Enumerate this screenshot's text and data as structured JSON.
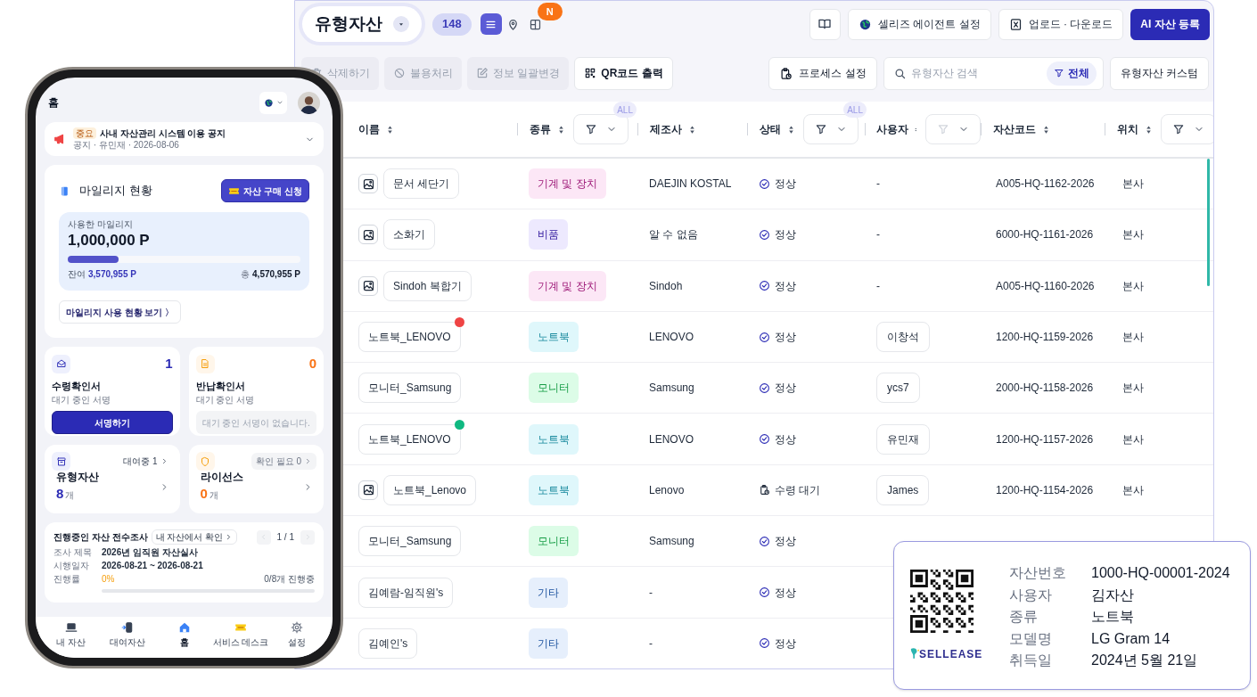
{
  "desktop": {
    "title": "유형자산",
    "count": "148",
    "views": [
      {
        "kind": "list",
        "selected": true
      },
      {
        "kind": "map",
        "selected": false
      },
      {
        "kind": "layout",
        "selected": false
      }
    ],
    "new_badge": "N",
    "actions": [
      {
        "kind": "book"
      },
      {
        "kind": "agent",
        "label": "셀리즈 에이전트 설정"
      },
      {
        "kind": "excel",
        "label": "업로드 · 다운로드"
      },
      {
        "kind": "primary",
        "label": "AI 자산 등록"
      }
    ],
    "toolbar": [
      {
        "kind": "trash",
        "label": "삭제하기",
        "disabled": true
      },
      {
        "kind": "ban",
        "label": "불용처리",
        "disabled": true
      },
      {
        "kind": "edit",
        "label": "정보 일괄변경",
        "disabled": true
      },
      {
        "kind": "qr",
        "label": "QR코드 출력",
        "disabled": false
      }
    ],
    "process_button": "프로세스 설정",
    "search": {
      "placeholder": "유형자산 검색",
      "filter_label": "전체"
    },
    "custom_button": "유형자산 커스텀",
    "table": {
      "columns": [
        {
          "label": "이름",
          "filter": false
        },
        {
          "label": "종류",
          "filter": true,
          "filter_dimmed": false,
          "badge": "ALL"
        },
        {
          "label": "제조사",
          "filter": false
        },
        {
          "label": "상태",
          "filter": true,
          "filter_dimmed": false,
          "badge": "ALL"
        },
        {
          "label": "사용자",
          "filter": true,
          "filter_dimmed": true
        },
        {
          "label": "자산코드",
          "filter": false
        },
        {
          "label": "위치",
          "filter": true,
          "filter_dimmed": false
        }
      ],
      "rows": [
        {
          "name": "문서 세단기",
          "has_image": true,
          "tag": {
            "label": "기계 및 장치",
            "color": "#fce7f6"
          },
          "maker": "DAEJIN KOSTAL",
          "status": {
            "kind": "normal",
            "label": "정상"
          },
          "user": {
            "kind": "plain",
            "label": "-"
          },
          "code": "A005-HQ-1162-2026",
          "location": "본사"
        },
        {
          "name": "소화기",
          "has_image": true,
          "tag": {
            "label": "비품",
            "color": "#ede9fe"
          },
          "maker": "알 수 없음",
          "status": {
            "kind": "normal",
            "label": "정상"
          },
          "user": {
            "kind": "plain",
            "label": "-"
          },
          "code": "6000-HQ-1161-2026",
          "location": "본사"
        },
        {
          "name": "Sindoh 복합기",
          "has_image": true,
          "tag": {
            "label": "기계 및 장치",
            "color": "#fce7f6"
          },
          "maker": "Sindoh",
          "status": {
            "kind": "normal",
            "label": "정상"
          },
          "user": {
            "kind": "plain",
            "label": "-"
          },
          "code": "A005-HQ-1160-2026",
          "location": "본사"
        },
        {
          "name": "노트북_LENOVO",
          "has_image": false,
          "dot": {
            "color": "#ef4444"
          },
          "tag": {
            "label": "노트북",
            "color": "#dff7fb"
          },
          "maker": "LENOVO",
          "status": {
            "kind": "normal",
            "label": "정상"
          },
          "user": {
            "kind": "pill",
            "label": "이창석"
          },
          "code": "1200-HQ-1159-2026",
          "location": "본사"
        },
        {
          "name": "모니터_Samsung",
          "has_image": false,
          "tag": {
            "label": "모니터",
            "color": "#dcfce7"
          },
          "maker": "Samsung",
          "status": {
            "kind": "normal",
            "label": "정상"
          },
          "user": {
            "kind": "pill",
            "label": "ycs7"
          },
          "code": "2000-HQ-1158-2026",
          "location": "본사"
        },
        {
          "name": "노트북_LENOVO",
          "has_image": false,
          "dot": {
            "color": "#10b981"
          },
          "tag": {
            "label": "노트북",
            "color": "#dff7fb"
          },
          "maker": "LENOVO",
          "status": {
            "kind": "normal",
            "label": "정상"
          },
          "user": {
            "kind": "pill",
            "label": "유민재"
          },
          "code": "1200-HQ-1157-2026",
          "location": "본사"
        },
        {
          "name": "노트북_Lenovo",
          "has_image": true,
          "tag": {
            "label": "노트북",
            "color": "#dff7fb"
          },
          "maker": "Lenovo",
          "status": {
            "kind": "pending",
            "label": "수령 대기"
          },
          "user": {
            "kind": "pill",
            "label": "James"
          },
          "code": "1200-HQ-1154-2026",
          "location": "본사"
        },
        {
          "name": "모니터_Samsung",
          "has_image": false,
          "tag": {
            "label": "모니터",
            "color": "#dcfce7"
          },
          "maker": "Samsung",
          "status": {
            "kind": "normal",
            "label": "정상"
          }
        },
        {
          "name": "김예람-임직원's",
          "has_image": false,
          "tag": {
            "label": "기타",
            "color": "#e6effc"
          },
          "maker": "-",
          "status": {
            "kind": "normal",
            "label": "정상"
          }
        },
        {
          "name": "김예인's",
          "has_image": false,
          "tag": {
            "label": "기타",
            "color": "#e6effc"
          },
          "maker": "-",
          "status": {
            "kind": "normal",
            "label": "정상"
          }
        }
      ]
    }
  },
  "phone": {
    "header_title": "홈",
    "notice": {
      "badge": "중요",
      "title": "사내 자산관리 시스템 이용 공지",
      "meta": "공지 · 유민재 · 2026-08-06"
    },
    "mileage": {
      "title": "마일리지 현황",
      "purchase_button": "자산 구매 신청",
      "used_label": "사용한 마일리지",
      "used_value": "1,000,000 P",
      "level": 0.22,
      "remain_label": "잔여",
      "remain_value": "3,570,955 P",
      "total_label": "총",
      "total_value": "4,570,955 P",
      "history_link": "마일리지 사용 현황 보기 〉"
    },
    "sign_cards": [
      {
        "kind": "receive",
        "count": "1",
        "title": "수령확인서",
        "subtitle": "대기 중인 서명",
        "action": "서명하기",
        "disabled": false
      },
      {
        "kind": "return",
        "count": "0",
        "title": "반납확인서",
        "subtitle": "대기 중인 서명",
        "action": "대기 중인 서명이 없습니다.",
        "disabled": true
      }
    ],
    "asset_cards": [
      {
        "kind": "tangible",
        "title": "유형자산",
        "count": "8",
        "unit": "개",
        "chip": "대여중 1",
        "chip_disabled": false
      },
      {
        "kind": "license",
        "title": "라이선스",
        "count": "0",
        "unit": "개",
        "chip": "확인 필요 0",
        "chip_disabled": true
      }
    ],
    "survey": {
      "title": "진행중인 자산 전수조사",
      "link": "내 자산에서 확인",
      "page": "1 / 1",
      "rows": [
        {
          "label": "조사 제목",
          "value": "2026년 임직원 자산실사"
        },
        {
          "label": "시행일자",
          "value": "2026-08-21 ~ 2026-08-21"
        }
      ],
      "progress_label": "진행률",
      "progress_value": "0%",
      "progress_note": "0/8개 진행중",
      "level": 0
    },
    "nav": [
      {
        "kind": "laptop",
        "label": "내 자산",
        "selected": false
      },
      {
        "kind": "mobile",
        "label": "대여자산",
        "selected": false
      },
      {
        "kind": "home",
        "label": "홈",
        "selected": true
      },
      {
        "kind": "ticket",
        "label": "서비스 데스크",
        "selected": false
      },
      {
        "kind": "gear",
        "label": "설정",
        "selected": false
      }
    ]
  },
  "label_card": {
    "brand": "SELLEASE",
    "fields": [
      {
        "label": "자산번호",
        "value": "1000-HQ-00001-2024"
      },
      {
        "label": "사용자",
        "value": "김자산"
      },
      {
        "label": "종류",
        "value": "노트북"
      },
      {
        "label": "모델명",
        "value": "LG Gram 14"
      },
      {
        "label": "취득일",
        "value": "2024년 5월 21일"
      }
    ]
  }
}
